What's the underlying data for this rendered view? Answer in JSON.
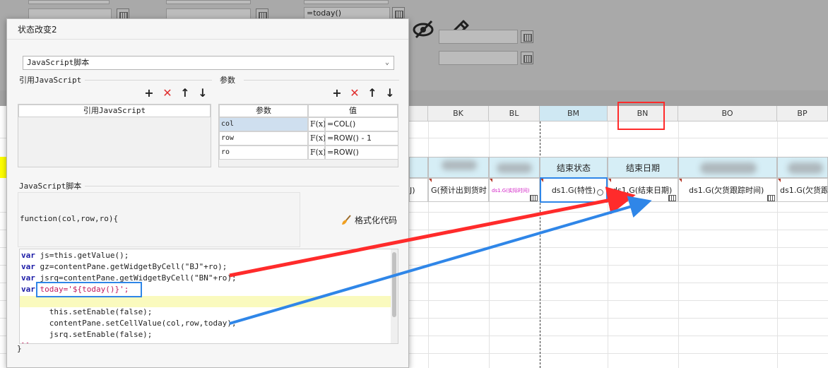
{
  "background": {
    "top_fields": {
      "today_value": "=today()"
    },
    "columns": [
      "BK",
      "BL",
      "BM",
      "BN",
      "BO",
      "BP"
    ],
    "header_row": {
      "bm": "结束状态",
      "bn": "结束日期"
    },
    "data_row": {
      "col_left_fragment": "J)",
      "bk": "G(预计出到货时",
      "bl": "ds1.G(实际时间)",
      "bm": "ds1.G(特性)",
      "bn": "ds1.G(结束日期)",
      "bo": "ds1.G(欠货跟踪时间)",
      "bp": "ds1.G(欠货跟"
    }
  },
  "dialog": {
    "title": "状态改变2",
    "type_select": "JavaScript脚本",
    "ref_js_label": "引用JavaScript",
    "ref_js_column": "引用JavaScript",
    "params_label": "参数",
    "params_columns": [
      "参数",
      "值"
    ],
    "params": [
      {
        "name": "col",
        "fx": "F(x)",
        "value": "=COL()"
      },
      {
        "name": "row",
        "fx": "F(x)",
        "value": "=ROW() - 1"
      },
      {
        "name": "ro",
        "fx": "F(x)",
        "value": "=ROW()"
      }
    ],
    "script_label": "JavaScript脚本",
    "function_signature": "function(col,row,ro){",
    "format_button": "格式化代码",
    "closing_brace": "}",
    "code_lines": [
      {
        "kw": "var",
        "rest": " js=this.getValue();"
      },
      {
        "kw": "var",
        "rest": " gz=contentPane.getWidgetByCell(\"BJ\"+ro);"
      },
      {
        "kw": "var",
        "rest": " jsrq=contentPane.getWidgetByCell(\"BN\"+ro);"
      },
      {
        "kw": "var",
        "rest": " today='${today()}';"
      },
      {
        "kw": "",
        "rest": ""
      },
      {
        "kw": "",
        "rest": "      this.setEnable(false);"
      },
      {
        "kw": "",
        "rest": "      contentPane.setCellValue(col,row,today);"
      },
      {
        "kw": "",
        "rest": "      jsrq.setEnable(false);"
      },
      {
        "kw": "",
        "rest": "}}"
      }
    ]
  },
  "colors": {
    "red_annotation": "#ff2b2b",
    "blue_annotation": "#2f86e8",
    "header_fill": "#d6eef6",
    "delete_icon": "#e03030"
  },
  "icons": [
    "add-icon",
    "delete-icon",
    "move-up-icon",
    "move-down-icon",
    "hide-icon",
    "edit-icon",
    "brush-icon",
    "calendar-icon",
    "dropdown-chevron-icon"
  ]
}
